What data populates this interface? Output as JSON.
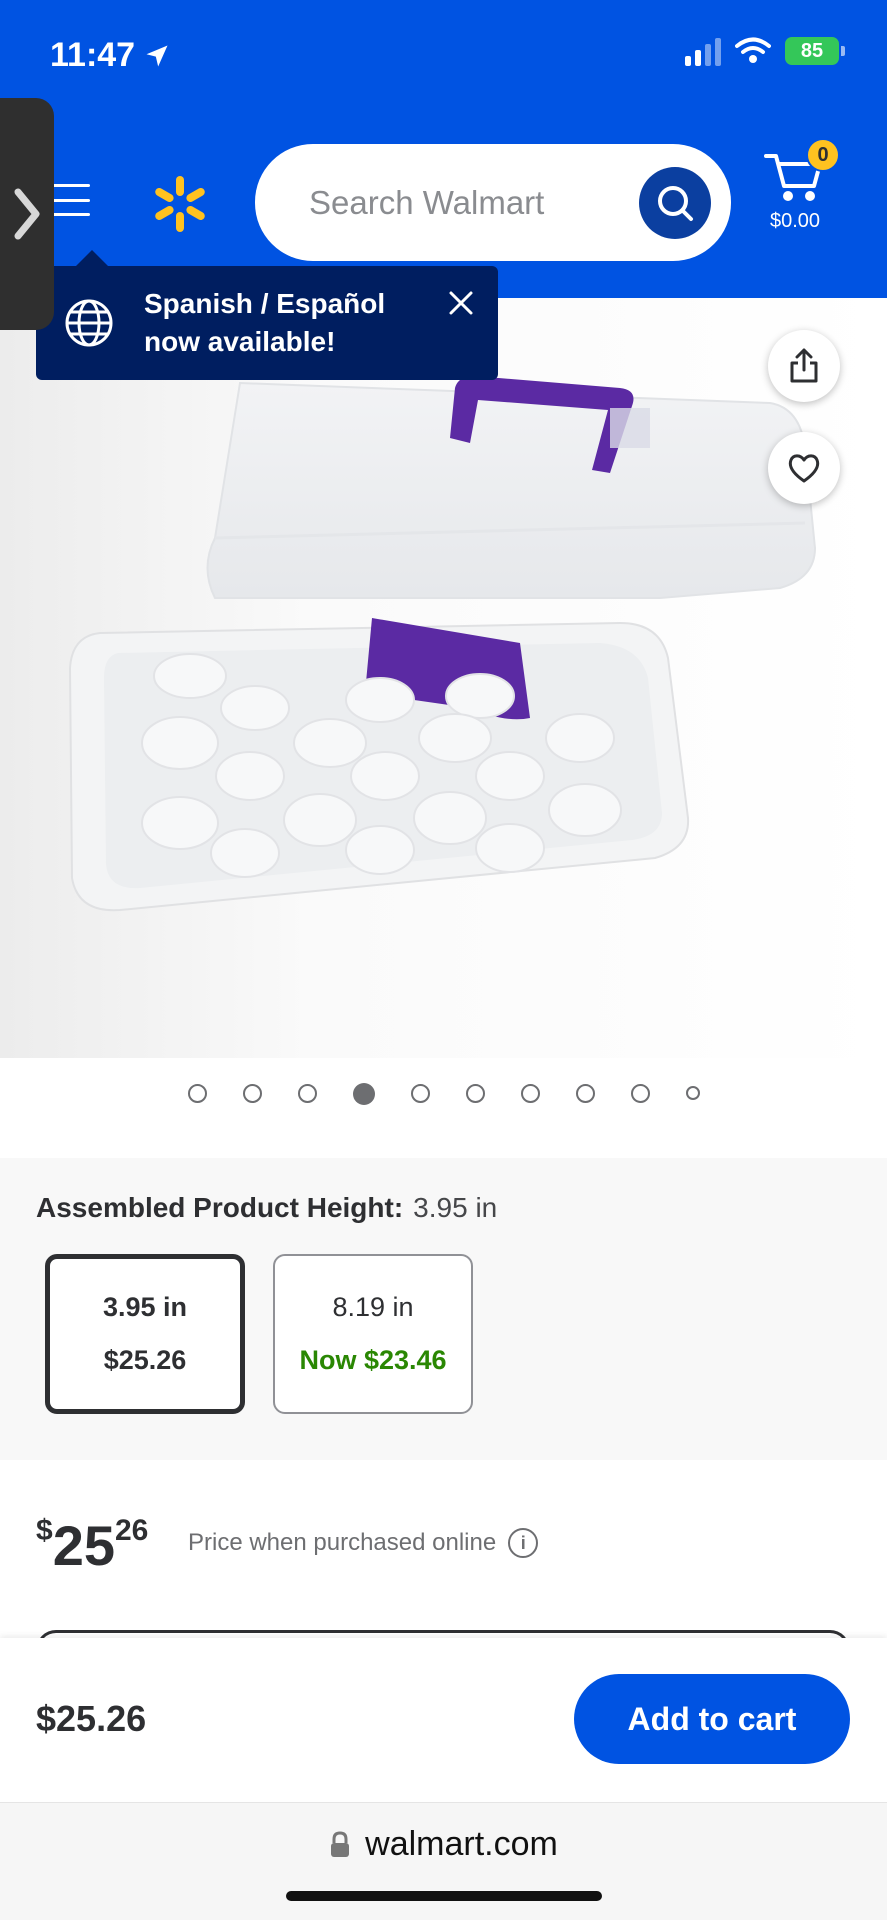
{
  "status_bar": {
    "time": "11:47",
    "battery": "85"
  },
  "header": {
    "search_placeholder": "Search Walmart",
    "cart_count": "0",
    "cart_amount": "$0.00"
  },
  "tooltip": {
    "text": "Spanish / Español now available!"
  },
  "gallery": {
    "image_count": 10,
    "active_index": 3
  },
  "variant": {
    "label": "Assembled Product Height:",
    "value": "3.95 in",
    "options": [
      {
        "size": "3.95 in",
        "price": "$25.26",
        "selected": true
      },
      {
        "size": "8.19 in",
        "price": "Now $23.46",
        "selected": false
      }
    ]
  },
  "price": {
    "currency": "$",
    "dollars": "25",
    "cents": "26",
    "note": "Price when purchased online"
  },
  "bottom_bar": {
    "price": "$25.26",
    "add_label": "Add to cart"
  },
  "browser": {
    "url": "walmart.com"
  },
  "colors": {
    "brand_blue": "#0053e2",
    "spark_yellow": "#ffc220",
    "now_green": "#2a8703",
    "product_purple": "#5b2aa3"
  }
}
